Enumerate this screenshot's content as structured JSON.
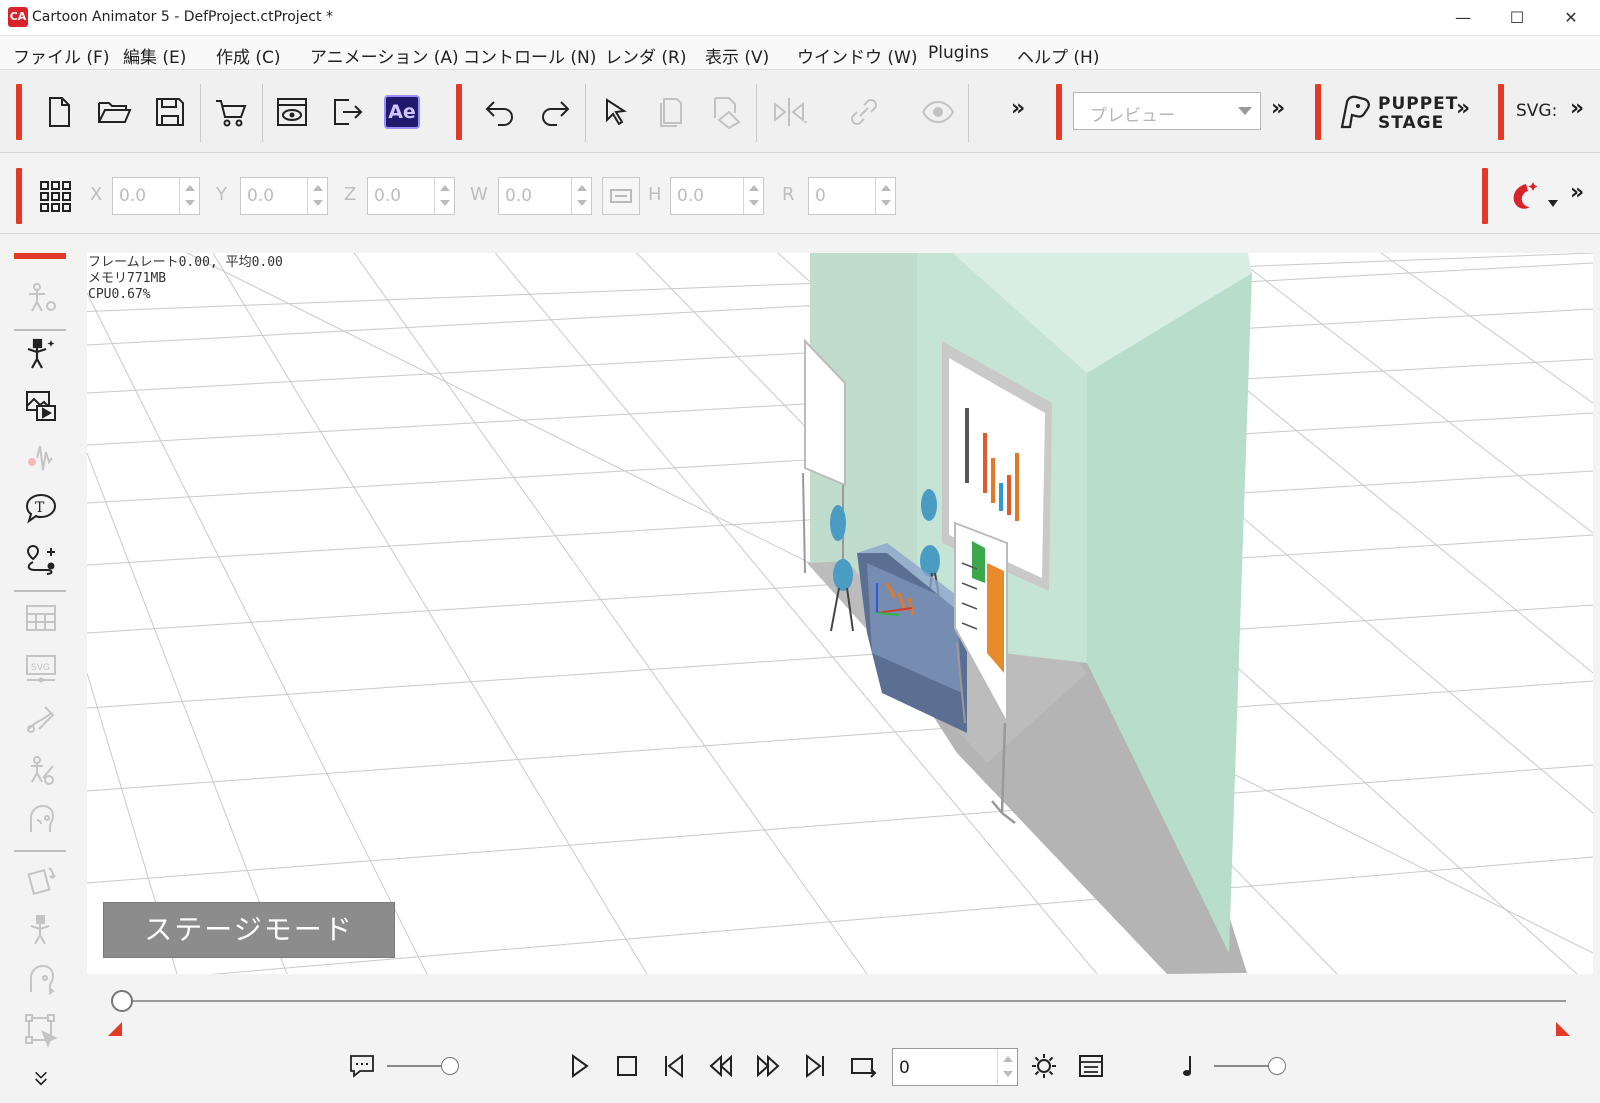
{
  "window": {
    "title": "Cartoon Animator 5 - DefProject.ctProject *",
    "logo_text": "CA",
    "minimize": "—",
    "maximize": "☐",
    "close": "✕"
  },
  "menu": [
    "ファイル (F)",
    "編集 (E)",
    "作成 (C)",
    "アニメーション (A)",
    "コントロール (N)",
    "レンダ (R)",
    "表示 (V)",
    "ウインドウ (W)",
    "Plugins",
    "ヘルプ (H)"
  ],
  "toolbar": {
    "ae_label": "Ae",
    "preview_placeholder": "プレビュー",
    "puppet_line1": "PUPPET",
    "puppet_line2": "STAGE",
    "svg_label": "SVG:",
    "more": "››"
  },
  "transform": {
    "x_label": "X",
    "x_value": "0.0",
    "y_label": "Y",
    "y_value": "0.0",
    "z_label": "Z",
    "z_value": "0.0",
    "w_label": "W",
    "w_value": "0.0",
    "h_label": "H",
    "h_value": "0.0",
    "r_label": "R",
    "r_value": "0"
  },
  "viewport": {
    "stats_line1": "フレームレート0.00, 平均0.00",
    "stats_line2": "メモリ771MB",
    "stats_line3": "CPU0.67%",
    "mode_badge": "ステージモード"
  },
  "timeline": {
    "frame_value": "0"
  },
  "colors": {
    "accent": "#e23a26",
    "wall": "#c5e4d6",
    "floor_shadow": "#b4b4b4"
  }
}
